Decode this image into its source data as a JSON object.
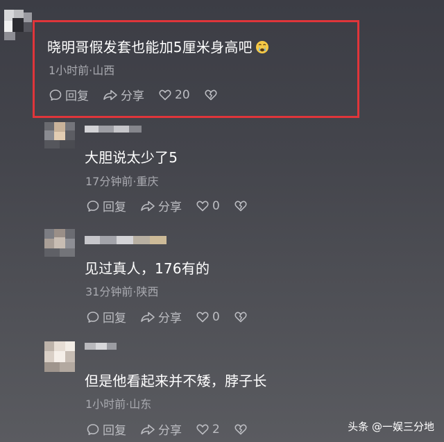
{
  "comments": [
    {
      "text": "晓明哥假发套也能加5厘米身高吧",
      "emoji": "crying-face",
      "meta": "1小时前·山西",
      "reply_label": "回复",
      "share_label": "分享",
      "likes": "20",
      "highlighted": true
    },
    {
      "text": "大胆说太少了5",
      "meta": "17分钟前·重庆",
      "reply_label": "回复",
      "share_label": "分享",
      "likes": "0"
    },
    {
      "text": "见过真人，176有的",
      "meta": "31分钟前·陕西",
      "reply_label": "回复",
      "share_label": "分享",
      "likes": "0"
    },
    {
      "text": "但是他看起来并不矮，脖子长",
      "meta": "1小时前·山东",
      "reply_label": "回复",
      "share_label": "分享",
      "likes": "2"
    }
  ],
  "watermark": "头条 @一娱三分地",
  "colors": {
    "highlight_border": "#e0353a",
    "meta_text": "#a9aab0",
    "action_text": "#bcbdc2"
  },
  "icons": [
    "reply-icon",
    "share-icon",
    "heart-icon",
    "dislike-icon",
    "crying-face-emoji"
  ]
}
